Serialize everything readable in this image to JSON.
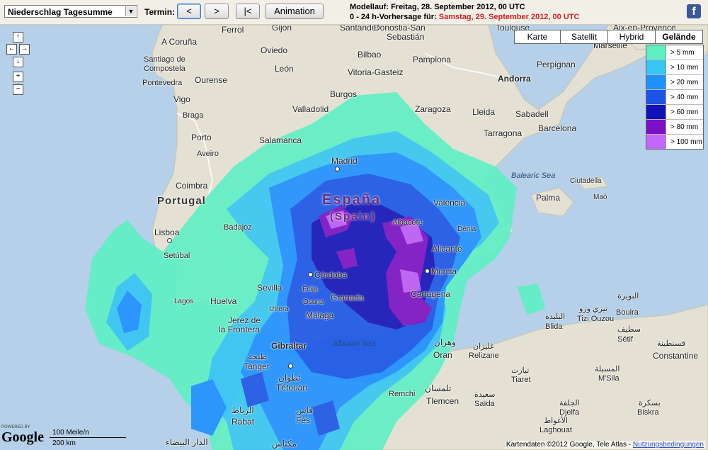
{
  "toolbar": {
    "dropdown_value": "Niederschlag Tagesumme",
    "termin_label": "Termin:",
    "prev_label": "<",
    "next_label": ">",
    "first_label": "|<",
    "animation_label": "Animation",
    "modellauf_label": "Modellauf:",
    "modellauf_value": "Freitag, 28. September 2012, 00 UTC",
    "vorhersage_label": "0 - 24 h-Vorhersage für:",
    "vorhersage_value": "Samstag, 29. September 2012, 00 UTC",
    "facebook_glyph": "f"
  },
  "map_types": {
    "karte": "Karte",
    "satellit": "Satellit",
    "hybrid": "Hybrid",
    "gelaende": "Gelände"
  },
  "legend": [
    {
      "label": "> 5 mm",
      "color": "#5ef0c4"
    },
    {
      "label": "> 10 mm",
      "color": "#35c6f3"
    },
    {
      "label": "> 20 mm",
      "color": "#1e90ff"
    },
    {
      "label": "> 40 mm",
      "color": "#1a55e6"
    },
    {
      "label": "> 60 mm",
      "color": "#1212b8"
    },
    {
      "label": "> 80 mm",
      "color": "#7b10c4"
    },
    {
      "label": "> 100 mm",
      "color": "#c467ff"
    }
  ],
  "nav": {
    "up": "↑",
    "left": "←",
    "right": "→",
    "down": "↓",
    "zoom_in": "+",
    "zoom_out": "−"
  },
  "places": {
    "country_es": "España",
    "country_es_sub": "(Spain)",
    "portugal": "Portugal",
    "andorra": "Andorra",
    "gibraltar": "Gibraltar",
    "balearic": "Balearic Sea",
    "alboran": "Alboran Sea",
    "a_coruna": "A Coruña",
    "gijon": "Gijon",
    "santander": "Santander",
    "donostia": "Donostia-San",
    "sebastian": "Sebastián",
    "aix": "Aix-en-Provence",
    "marseille": "Marseille",
    "ferrol": "Ferrol",
    "oviedo": "Oviedo",
    "bilbao": "Bilbao",
    "pamplona": "Pamplona",
    "toulouse": "Toulouse",
    "santiago": "Santiago de",
    "compostela": "Compostela",
    "leon": "León",
    "vitoria": "Vitoria-Gasteiz",
    "perpignan": "Perpignan",
    "pontevedra": "Pontevedra",
    "ourense": "Ourense",
    "burgos": "Burgos",
    "vigo": "Vigo",
    "braga": "Braga",
    "valladolid": "Valladolid",
    "zaragoza": "Zaragoza",
    "lleida": "Lleida",
    "sabadell": "Sabadell",
    "porto": "Porto",
    "salamanca": "Salamanca",
    "tarragona": "Tarragona",
    "barcelona": "Barcelona",
    "aveiro": "Aveiro",
    "madrid": "Madrid",
    "coimbra": "Coimbra",
    "palma": "Palma",
    "ciutadella": "Ciutadella",
    "mao": "Maó",
    "valencia": "Valencia",
    "lisboa": "Lisboa",
    "badajoz": "Badajoz",
    "albacete": "Albacete",
    "denia": "Dénia",
    "setubal": "Setúbal",
    "alicante": "Alicante",
    "cordoba": "Córdoba",
    "murcia": "Murcia",
    "sevilla": "Sevilla",
    "ecija": "Écija",
    "cartagena": "Cartagena",
    "lagos": "Lagos",
    "huelva": "Huelva",
    "osuna": "Osuna",
    "granada": "Granada",
    "jerez": "Jerez de",
    "frontera": "la Frontera",
    "utrera": "Utrera",
    "malaga": "Málaga",
    "tanger": "Tanger",
    "tetouan": "Tétouan",
    "oran": "Oran",
    "relizane": "Relizane",
    "tiaret": "Tiaret",
    "msila": "M'Sila",
    "biskra": "Biskra",
    "constantine": "Constantine",
    "setif": "Sétif",
    "tizi_ouzou": "Tizi Ouzou",
    "bouira": "Bouira",
    "blida": "Blida",
    "remchi": "Remchi",
    "tlemcen": "Tlemcen",
    "saida": "Saïda",
    "djelfa": "Djelfa",
    "rabat": "Rabat",
    "fes": "Fès",
    "laghouat": "Laghouat",
    "ar_tanger": "طنجة",
    "ar_tetouan": "تطوان",
    "ar_rabat": "الرباط",
    "ar_fes": "فاس",
    "ar_oran": "وهران",
    "ar_relizane": "غليزان",
    "ar_tiaret": "تيارت",
    "ar_msila": "المسيلة",
    "ar_biskra": "بسكرة",
    "ar_constantine": "قسنطينة",
    "ar_setif": "سطيف",
    "ar_tizi": "تيزي وزو",
    "ar_bouira": "البويرة",
    "ar_blida": "البليدة",
    "ar_tlemcen": "تلمسان",
    "ar_saida": "سعيدة",
    "ar_djelfa": "الجلفة",
    "ar_laghouat": "الأغواط",
    "ar_casa": "الدار البيضاء",
    "ar_meknes": "مكناس"
  },
  "scale": {
    "miles": "100 Meile/n",
    "km": "200 km"
  },
  "google": {
    "powered": "POWERED BY",
    "logo": "Google"
  },
  "copyright": {
    "text": "Kartendaten ©2012 Google, Tele Atlas - ",
    "link": "Nutzungsbedingungen"
  }
}
